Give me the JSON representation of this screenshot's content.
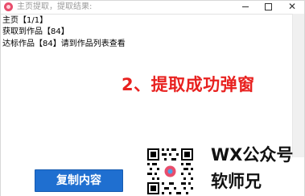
{
  "window": {
    "title": "主页提取，提取结果:",
    "controls": {
      "minimize_icon": "minimize-icon",
      "maximize_icon": "maximize-icon",
      "close_icon": "close-icon",
      "close_glyph": "✕"
    }
  },
  "results": {
    "lines": [
      "主页【1/1】",
      "获取到作品【84】",
      "达标作品【84】请到作品列表查看"
    ]
  },
  "overlay": {
    "caption": "2、提取成功弹窗"
  },
  "actions": {
    "copy_label": "复制内容"
  },
  "promo": {
    "wx_text": "WX公众号",
    "author": "软师兄"
  },
  "colors": {
    "accent_button": "#1f6fd0",
    "caption_red": "#e8211f",
    "app_icon": "#e84d6c"
  }
}
